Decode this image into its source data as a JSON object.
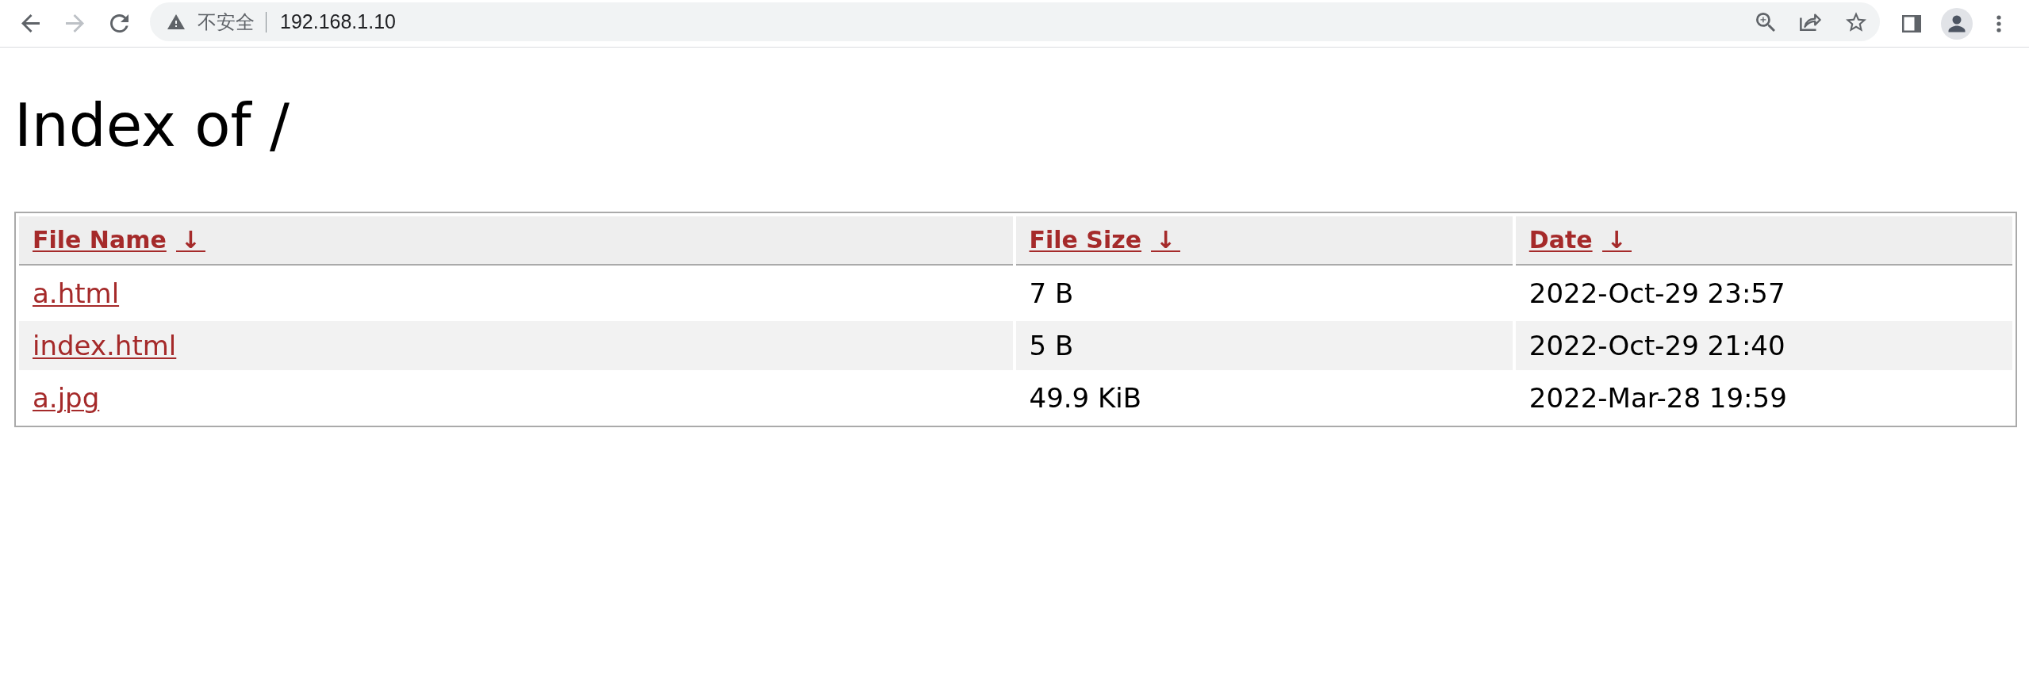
{
  "browser": {
    "nav_buttons": [
      {
        "kind": "back",
        "disabled": false
      },
      {
        "kind": "forward",
        "disabled": true
      },
      {
        "kind": "reload",
        "disabled": false
      }
    ],
    "address_bar": {
      "security_label": "不安全",
      "url": "192.168.1.10"
    }
  },
  "page": {
    "title": "Index of /",
    "table": {
      "columns": [
        {
          "label": "File Name",
          "sort_arrow": "↓"
        },
        {
          "label": "File Size",
          "sort_arrow": "↓"
        },
        {
          "label": "Date",
          "sort_arrow": "↓"
        }
      ],
      "rows": [
        {
          "name": "a.html",
          "size": "7 B",
          "date": "2022-Oct-29 23:57"
        },
        {
          "name": "index.html",
          "size": "5 B",
          "date": "2022-Oct-29 21:40"
        },
        {
          "name": "a.jpg",
          "size": "49.9 KiB",
          "date": "2022-Mar-28 19:59"
        }
      ]
    }
  }
}
